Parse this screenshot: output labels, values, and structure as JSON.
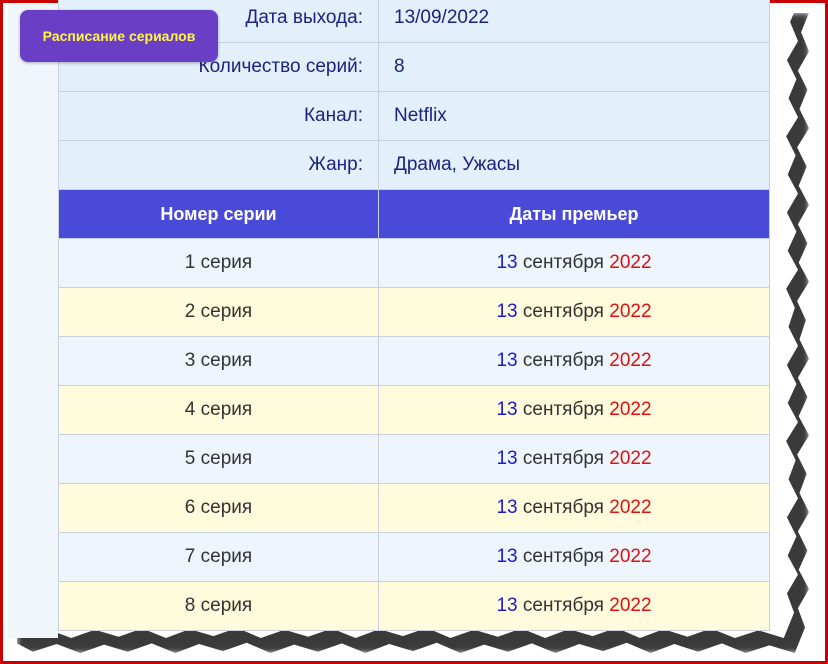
{
  "badge": {
    "label": "Расписание сериалов"
  },
  "info": [
    {
      "label": "Дата выхода:",
      "value": "13/09/2022"
    },
    {
      "label": "Количество серий:",
      "value": "8"
    },
    {
      "label": "Канал:",
      "value": "Netflix"
    },
    {
      "label": "Жанр:",
      "value": "Драма, Ужасы"
    }
  ],
  "table": {
    "col_episode": "Номер серии",
    "col_dates": "Даты премьер",
    "rows": [
      {
        "episode": "1 серия",
        "day": "13",
        "month": "сентября",
        "year": "2022"
      },
      {
        "episode": "2 серия",
        "day": "13",
        "month": "сентября",
        "year": "2022"
      },
      {
        "episode": "3 серия",
        "day": "13",
        "month": "сентября",
        "year": "2022"
      },
      {
        "episode": "4 серия",
        "day": "13",
        "month": "сентября",
        "year": "2022"
      },
      {
        "episode": "5 серия",
        "day": "13",
        "month": "сентября",
        "year": "2022"
      },
      {
        "episode": "6 серия",
        "day": "13",
        "month": "сентября",
        "year": "2022"
      },
      {
        "episode": "7 серия",
        "day": "13",
        "month": "сентября",
        "year": "2022"
      },
      {
        "episode": "8 серия",
        "day": "13",
        "month": "сентября",
        "year": "2022"
      }
    ]
  },
  "colors": {
    "frame": "#c80000",
    "header_bg": "#4a4ad9",
    "badge_bg": "#6a3fc6",
    "badge_text": "#fff44a",
    "day": "#1a1ad0",
    "year": "#e01010"
  }
}
